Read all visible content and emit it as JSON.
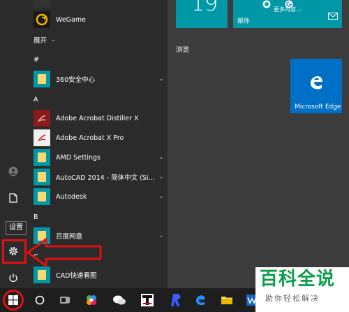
{
  "rail": {
    "tooltip": "设置",
    "icons": [
      "user-icon",
      "document-icon",
      "gear-icon",
      "power-icon"
    ]
  },
  "apps": {
    "top_partial": "",
    "wegame": "WeGame",
    "collapse": "展开",
    "sections": [
      {
        "letter": "#",
        "items": [
          {
            "label": "360安全中心",
            "expandable": true
          }
        ]
      },
      {
        "letter": "A",
        "items": [
          {
            "label": "Adobe Acrobat Distiller X",
            "expandable": false
          },
          {
            "label": "Adobe Acrobat X Pro",
            "expandable": false
          },
          {
            "label": "AMD Settings",
            "expandable": true
          },
          {
            "label": "AutoCAD 2014 - 简体中文 (Si...",
            "expandable": true
          },
          {
            "label": "Autodesk",
            "expandable": true
          }
        ]
      },
      {
        "letter": "B",
        "items": [
          {
            "label": "百度网盘",
            "expandable": true
          }
        ]
      },
      {
        "letter": "C",
        "items": [
          {
            "label": "CAD快速看图",
            "expandable": false
          }
        ]
      }
    ]
  },
  "tiles": {
    "calendar_day": "19",
    "mail_more": "更多内容...",
    "mail_label": "邮件",
    "browse_section": "浏览",
    "edge_label": "Microsoft Edge"
  },
  "watermark": {
    "main": "百科全说",
    "sub": "助你轻松解决"
  },
  "colors": {
    "accent": "#0097a7",
    "edge": "#0070c7",
    "highlight": "#e01010",
    "folder": "#f8d775"
  }
}
